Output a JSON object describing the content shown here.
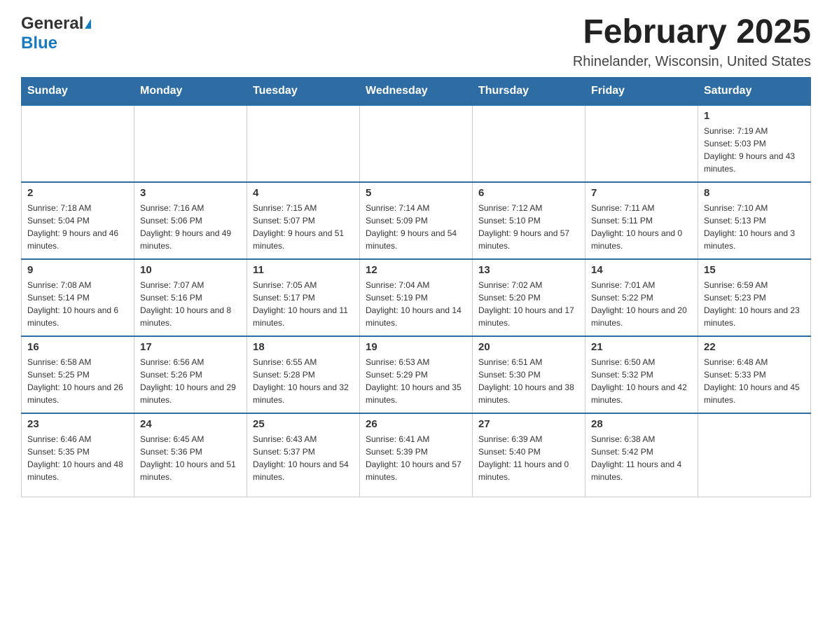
{
  "header": {
    "logo_general": "General",
    "logo_blue": "Blue",
    "title": "February 2025",
    "subtitle": "Rhinelander, Wisconsin, United States"
  },
  "days_of_week": [
    "Sunday",
    "Monday",
    "Tuesday",
    "Wednesday",
    "Thursday",
    "Friday",
    "Saturday"
  ],
  "weeks": [
    [
      {
        "day": "",
        "info": ""
      },
      {
        "day": "",
        "info": ""
      },
      {
        "day": "",
        "info": ""
      },
      {
        "day": "",
        "info": ""
      },
      {
        "day": "",
        "info": ""
      },
      {
        "day": "",
        "info": ""
      },
      {
        "day": "1",
        "info": "Sunrise: 7:19 AM\nSunset: 5:03 PM\nDaylight: 9 hours and 43 minutes."
      }
    ],
    [
      {
        "day": "2",
        "info": "Sunrise: 7:18 AM\nSunset: 5:04 PM\nDaylight: 9 hours and 46 minutes."
      },
      {
        "day": "3",
        "info": "Sunrise: 7:16 AM\nSunset: 5:06 PM\nDaylight: 9 hours and 49 minutes."
      },
      {
        "day": "4",
        "info": "Sunrise: 7:15 AM\nSunset: 5:07 PM\nDaylight: 9 hours and 51 minutes."
      },
      {
        "day": "5",
        "info": "Sunrise: 7:14 AM\nSunset: 5:09 PM\nDaylight: 9 hours and 54 minutes."
      },
      {
        "day": "6",
        "info": "Sunrise: 7:12 AM\nSunset: 5:10 PM\nDaylight: 9 hours and 57 minutes."
      },
      {
        "day": "7",
        "info": "Sunrise: 7:11 AM\nSunset: 5:11 PM\nDaylight: 10 hours and 0 minutes."
      },
      {
        "day": "8",
        "info": "Sunrise: 7:10 AM\nSunset: 5:13 PM\nDaylight: 10 hours and 3 minutes."
      }
    ],
    [
      {
        "day": "9",
        "info": "Sunrise: 7:08 AM\nSunset: 5:14 PM\nDaylight: 10 hours and 6 minutes."
      },
      {
        "day": "10",
        "info": "Sunrise: 7:07 AM\nSunset: 5:16 PM\nDaylight: 10 hours and 8 minutes."
      },
      {
        "day": "11",
        "info": "Sunrise: 7:05 AM\nSunset: 5:17 PM\nDaylight: 10 hours and 11 minutes."
      },
      {
        "day": "12",
        "info": "Sunrise: 7:04 AM\nSunset: 5:19 PM\nDaylight: 10 hours and 14 minutes."
      },
      {
        "day": "13",
        "info": "Sunrise: 7:02 AM\nSunset: 5:20 PM\nDaylight: 10 hours and 17 minutes."
      },
      {
        "day": "14",
        "info": "Sunrise: 7:01 AM\nSunset: 5:22 PM\nDaylight: 10 hours and 20 minutes."
      },
      {
        "day": "15",
        "info": "Sunrise: 6:59 AM\nSunset: 5:23 PM\nDaylight: 10 hours and 23 minutes."
      }
    ],
    [
      {
        "day": "16",
        "info": "Sunrise: 6:58 AM\nSunset: 5:25 PM\nDaylight: 10 hours and 26 minutes."
      },
      {
        "day": "17",
        "info": "Sunrise: 6:56 AM\nSunset: 5:26 PM\nDaylight: 10 hours and 29 minutes."
      },
      {
        "day": "18",
        "info": "Sunrise: 6:55 AM\nSunset: 5:28 PM\nDaylight: 10 hours and 32 minutes."
      },
      {
        "day": "19",
        "info": "Sunrise: 6:53 AM\nSunset: 5:29 PM\nDaylight: 10 hours and 35 minutes."
      },
      {
        "day": "20",
        "info": "Sunrise: 6:51 AM\nSunset: 5:30 PM\nDaylight: 10 hours and 38 minutes."
      },
      {
        "day": "21",
        "info": "Sunrise: 6:50 AM\nSunset: 5:32 PM\nDaylight: 10 hours and 42 minutes."
      },
      {
        "day": "22",
        "info": "Sunrise: 6:48 AM\nSunset: 5:33 PM\nDaylight: 10 hours and 45 minutes."
      }
    ],
    [
      {
        "day": "23",
        "info": "Sunrise: 6:46 AM\nSunset: 5:35 PM\nDaylight: 10 hours and 48 minutes."
      },
      {
        "day": "24",
        "info": "Sunrise: 6:45 AM\nSunset: 5:36 PM\nDaylight: 10 hours and 51 minutes."
      },
      {
        "day": "25",
        "info": "Sunrise: 6:43 AM\nSunset: 5:37 PM\nDaylight: 10 hours and 54 minutes."
      },
      {
        "day": "26",
        "info": "Sunrise: 6:41 AM\nSunset: 5:39 PM\nDaylight: 10 hours and 57 minutes."
      },
      {
        "day": "27",
        "info": "Sunrise: 6:39 AM\nSunset: 5:40 PM\nDaylight: 11 hours and 0 minutes."
      },
      {
        "day": "28",
        "info": "Sunrise: 6:38 AM\nSunset: 5:42 PM\nDaylight: 11 hours and 4 minutes."
      },
      {
        "day": "",
        "info": ""
      }
    ]
  ]
}
